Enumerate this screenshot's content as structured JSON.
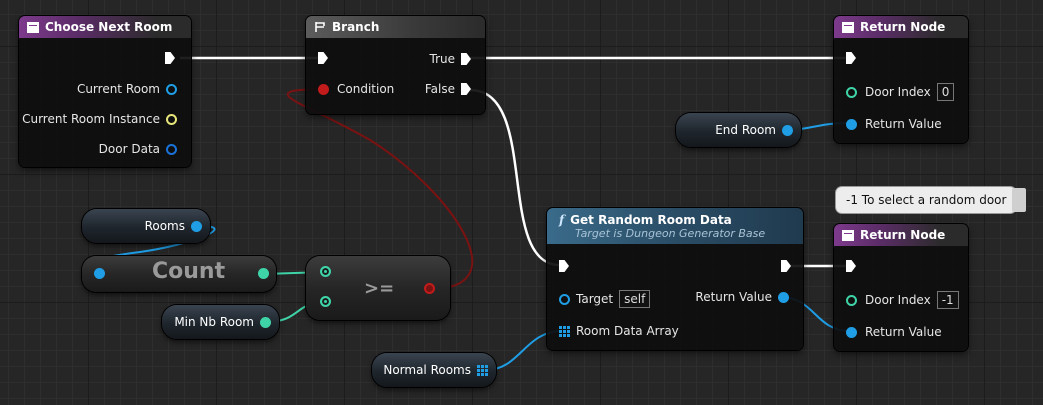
{
  "nodes": {
    "choose_next_room": {
      "title": "Choose Next Room",
      "pins": [
        "Current Room",
        "Current Room Instance",
        "Door Data"
      ]
    },
    "branch": {
      "title": "Branch",
      "condition": "Condition",
      "true_label": "True",
      "false_label": "False"
    },
    "return_top": {
      "title": "Return Node",
      "door_index_label": "Door Index",
      "door_index_value": "0",
      "return_value_label": "Return Value"
    },
    "end_room": {
      "label": "End Room"
    },
    "rooms": {
      "label": "Rooms"
    },
    "count": {
      "label": "Count"
    },
    "ge": {
      "label": ">="
    },
    "min_nb_room": {
      "label": "Min Nb Room"
    },
    "get_random_room_data": {
      "title": "Get Random Room Data",
      "subtitle": "Target is Dungeon Generator Base",
      "target_label": "Target",
      "target_value": "self",
      "room_data_array_label": "Room Data Array",
      "return_value_label": "Return Value"
    },
    "normal_rooms": {
      "label": "Normal Rooms"
    },
    "comment": {
      "text": "-1 To select a random door"
    },
    "return_bottom": {
      "title": "Return Node",
      "door_index_label": "Door Index",
      "door_index_value": "-1",
      "return_value_label": "Return Value"
    }
  },
  "colors": {
    "exec_wire": "#ffffff",
    "bool_wire": "#7a1212",
    "object_wire": "#1f9ee6",
    "int_wire": "#3fd4a8",
    "function_header": "#7d3a8c",
    "pure_function_header": "#3a6b8a"
  },
  "icons": [
    "function-icon",
    "branch-icon",
    "exec-pin-icon",
    "object-pin-icon",
    "array-pin-icon",
    "pin-comment-icon"
  ]
}
